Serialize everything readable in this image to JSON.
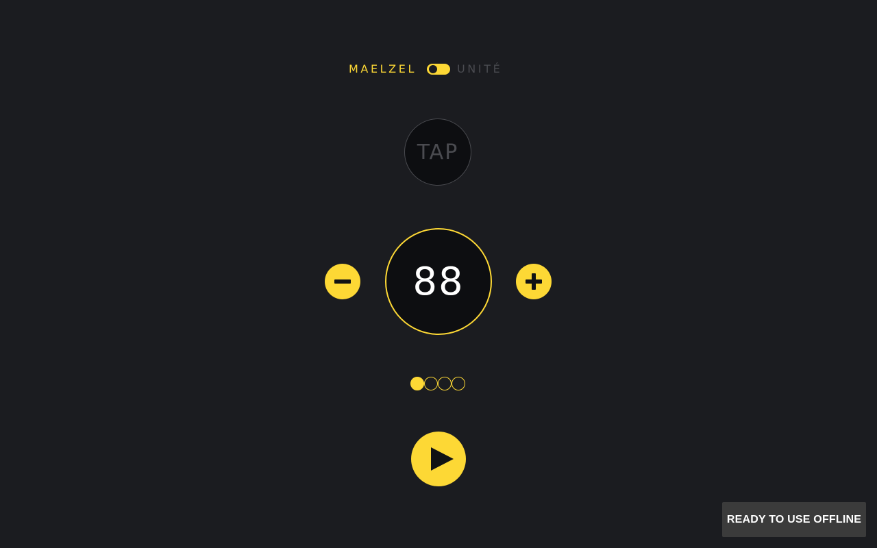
{
  "mode": {
    "left_label": "MAELZEL",
    "right_label": "UNITÉ",
    "toggle_state": "left"
  },
  "tap": {
    "label": "TAP"
  },
  "tempo": {
    "value": "88"
  },
  "controls": {
    "decrease_icon": "minus-icon",
    "increase_icon": "plus-icon",
    "play_icon": "play-icon"
  },
  "beats": {
    "count": 4,
    "active_index": 0
  },
  "toast": {
    "message": "READY TO USE OFFLINE"
  },
  "colors": {
    "background": "#1b1c20",
    "accent": "#fdd835",
    "dial_fill": "#0d0e11",
    "muted": "#4a4b50",
    "toast_bg": "#3b3b3b"
  }
}
